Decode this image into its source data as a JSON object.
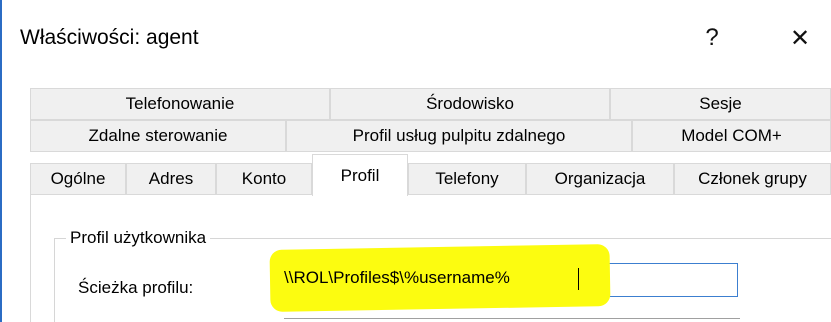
{
  "window": {
    "title": "Właściwości: agent",
    "help_label": "?",
    "close_label": "✕"
  },
  "tabs": {
    "row1": [
      "Telefonowanie",
      "Środowisko",
      "Sesje"
    ],
    "row2": [
      "Zdalne sterowanie",
      "Profil usług pulpitu zdalnego",
      "Model COM+"
    ],
    "row3": [
      "Ogólne",
      "Adres",
      "Konto",
      "Profil",
      "Telefony",
      "Organizacja",
      "Członek grupy"
    ],
    "active": "Profil"
  },
  "profile": {
    "group_label": "Profil użytkownika",
    "path_label": "Ścieżka profilu:",
    "path_value": "\\\\ROL\\Profiles$\\%username%"
  },
  "colors": {
    "highlight": "#fcfc10",
    "focus_border": "#3c7fd0"
  }
}
